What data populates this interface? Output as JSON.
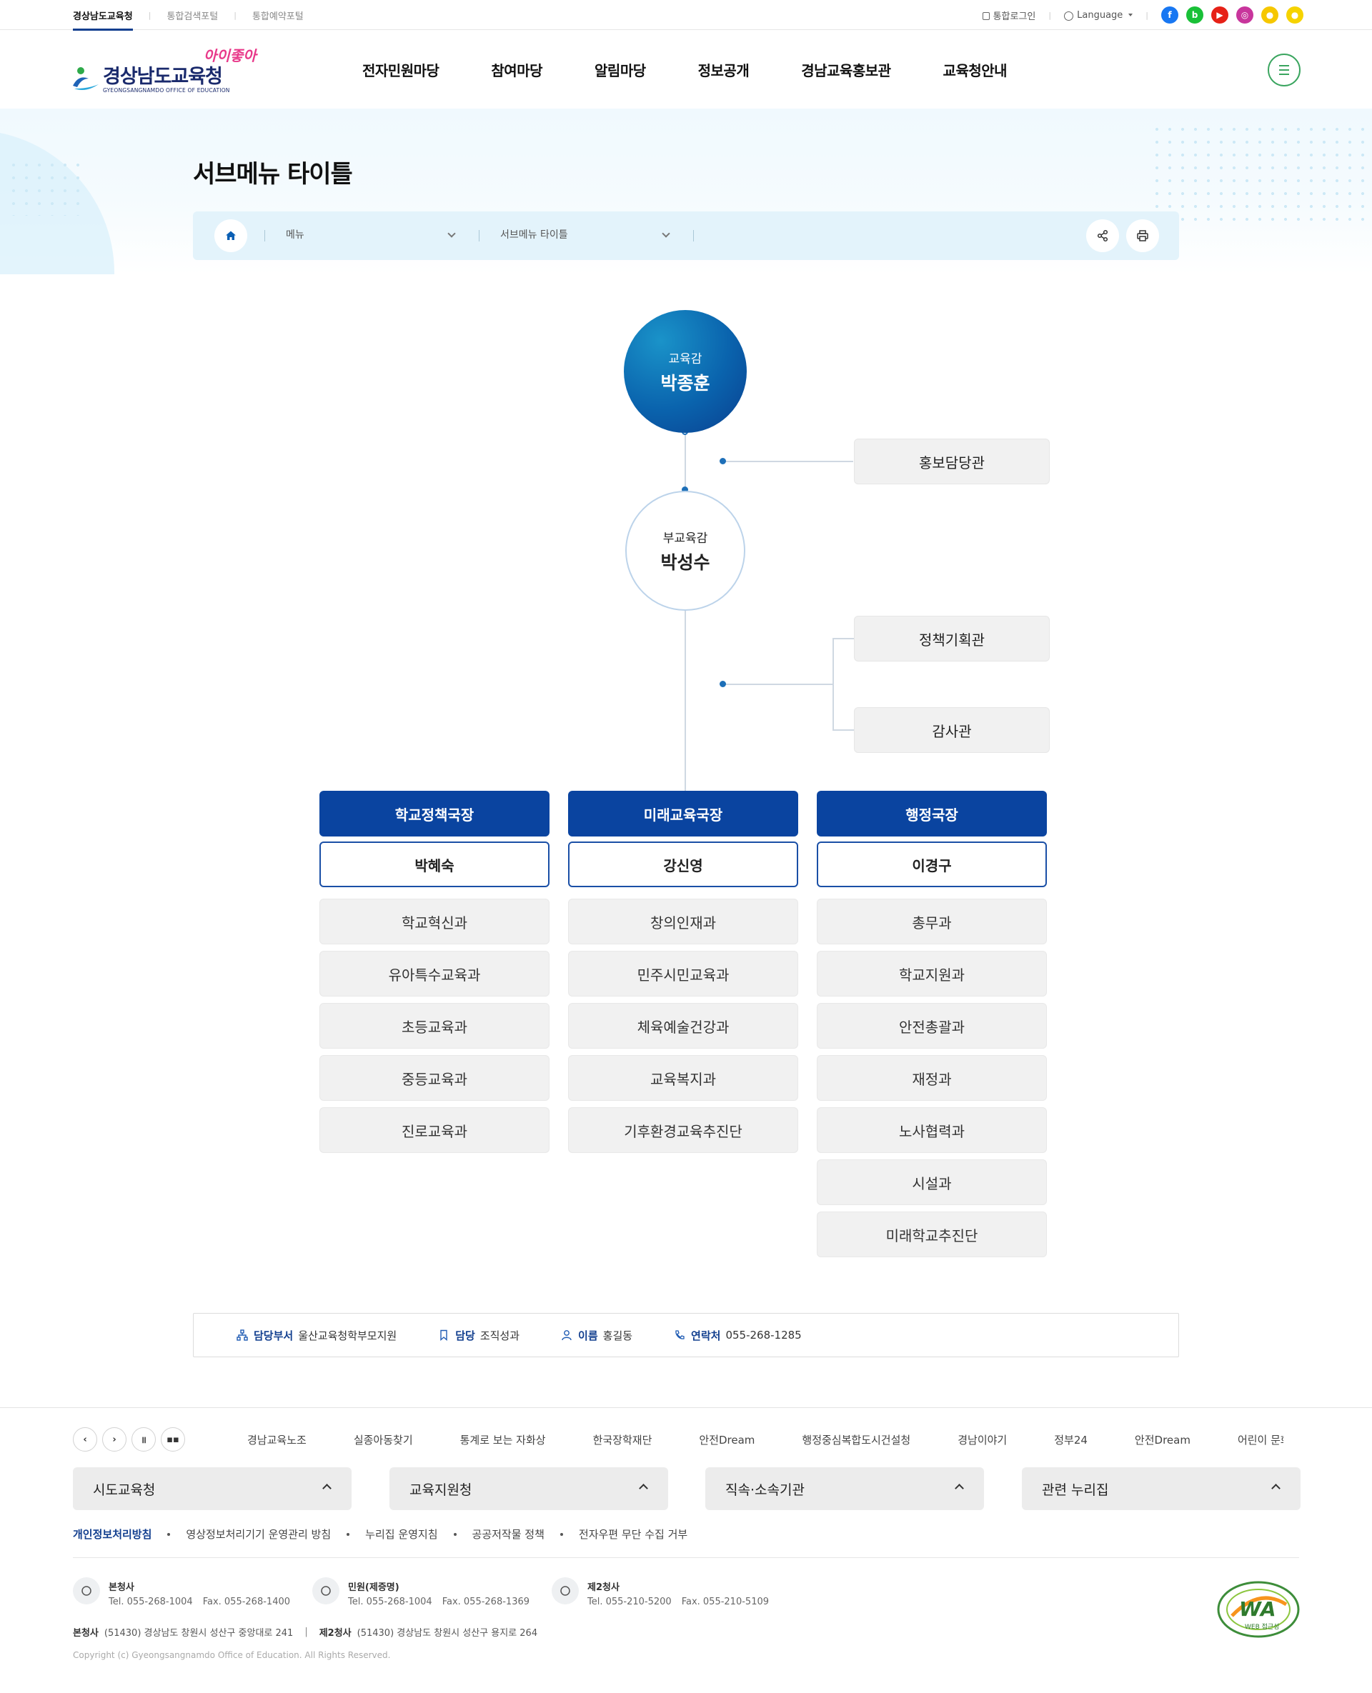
{
  "util": {
    "links": [
      "경상남도교육청",
      "통합검색포털",
      "통합예약포털"
    ],
    "login": "통합로그인",
    "language": "Language"
  },
  "sns": [
    {
      "name": "facebook-icon",
      "color": "#1877f2",
      "glyph": "f"
    },
    {
      "name": "blog-icon",
      "color": "#19c037",
      "glyph": "b"
    },
    {
      "name": "youtube-icon",
      "color": "#e62117",
      "glyph": "▶"
    },
    {
      "name": "instagram-icon",
      "color": "#c8359c",
      "glyph": "◎"
    },
    {
      "name": "kakaostory-icon",
      "color": "#f6c700",
      "glyph": "●"
    },
    {
      "name": "kakaotalk-icon",
      "color": "#f6d300",
      "glyph": "●"
    }
  ],
  "logo": {
    "main": "경상남도교육청",
    "sub": "GYEONGSANGNAMDO OFFICE OF EDUCATION",
    "slogan": "아이좋아"
  },
  "gnb": [
    "전자민원마당",
    "참여마당",
    "알림마당",
    "정보공개",
    "경남교육홍보관",
    "교육청안내"
  ],
  "page": {
    "title": "서브메뉴 타이틀",
    "breadcrumb": [
      "메뉴",
      "서브메뉴 타이틀"
    ]
  },
  "org": {
    "top": {
      "role": "교육감",
      "name": "박종훈"
    },
    "pr": "홍보담당관",
    "second": {
      "role": "부교육감",
      "name": "박성수"
    },
    "side": [
      "정책기획관",
      "감사관"
    ],
    "columns": [
      {
        "head": "학교정책국장",
        "name": "박혜숙",
        "depts": [
          "학교혁신과",
          "유아특수교육과",
          "초등교육과",
          "중등교육과",
          "진로교육과"
        ]
      },
      {
        "head": "미래교육국장",
        "name": "강신영",
        "depts": [
          "창의인재과",
          "민주시민교육과",
          "체육예술건강과",
          "교육복지과",
          "기후환경교육추진단"
        ]
      },
      {
        "head": "행정국장",
        "name": "이경구",
        "depts": [
          "총무과",
          "학교지원과",
          "안전총괄과",
          "재정과",
          "노사협력과",
          "시설과",
          "미래학교추진단"
        ]
      }
    ]
  },
  "info": {
    "dept_label": "담당부서",
    "dept_value": "울산교육청학부모지원",
    "charge_label": "담당",
    "charge_value": "조직성과",
    "name_label": "이름",
    "name_value": "홍길동",
    "contact_label": "연락처",
    "contact_value": "055-268-1285"
  },
  "footer": {
    "banners": [
      "경남교육노조",
      "실종아동찾기",
      "통계로 보는 자화상",
      "한국장학재단",
      "안전Dream",
      "행정중심복합도시건설청",
      "경남이야기",
      "정부24",
      "안전Dream",
      "어린이 문화"
    ],
    "family": [
      "시도교육청",
      "교육지원청",
      "직속·소속기관",
      "관련 누리집"
    ],
    "policy": [
      "개인정보처리방침",
      "영상정보처리기기 운영관리 방침",
      "누리집 운영지침",
      "공공저작물 정책",
      "전자우편 무단 수집 거부"
    ],
    "contacts": [
      {
        "title": "본청사",
        "tel": "Tel. 055-268-1004",
        "fax": "Fax. 055-268-1400"
      },
      {
        "title": "민원(제증명)",
        "tel": "Tel. 055-268-1004",
        "fax": "Fax. 055-268-1369"
      },
      {
        "title": "제2청사",
        "tel": "Tel. 055-210-5200",
        "fax": "Fax. 055-210-5109"
      }
    ],
    "addr1_label": "본청사",
    "addr1": "(51430) 경상남도 창원시 성산구 중앙대로 241",
    "addr2_label": "제2청사",
    "addr2": "(51430) 경상남도 창원시 성산구 용지로 264",
    "copyright": "Copyright (c) Gyeongsangnamdo Office of Education. All Rights Reserved.",
    "wa_mark": "WA",
    "wa_sub": "WEB 접근성"
  }
}
